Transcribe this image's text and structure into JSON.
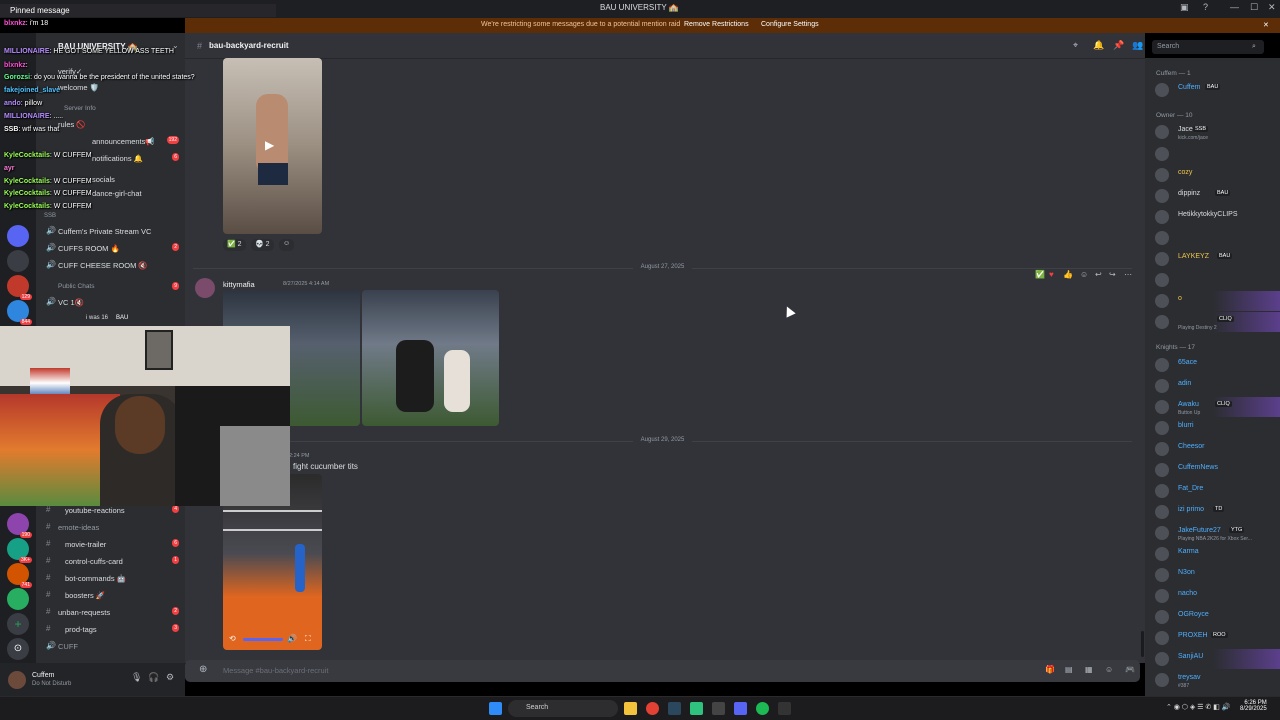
{
  "window": {
    "title": "BAU UNIVERSITY 🏫",
    "notice": "We're restricting some messages due to a potential mention raid",
    "notice_btn1": "Remove Restrictions",
    "notice_btn2": "Configure Settings"
  },
  "chat_overlay": {
    "pinned": "Pinned message",
    "lines": [
      {
        "nick": "blxnkz",
        "color": "#ff4fd8",
        "text": ": i'm 18"
      },
      {
        "nick": "MILLIONAIRE",
        "color": "#b58cff",
        "text": ": HE GOT SOME YELLOW ASS TEETH"
      },
      {
        "nick": "blxnkz",
        "color": "#ff4fd8",
        "text": ":"
      },
      {
        "nick": "Gorozsi",
        "color": "#63ff90",
        "text": ": do you wanna be the president of the united states?"
      },
      {
        "nick": "fakejoined_slave",
        "color": "#4fc3ff",
        "text": ""
      },
      {
        "nick": "ando",
        "color": "#b58cff",
        "text": ": pillow"
      },
      {
        "nick": "MILLIONAIRE",
        "color": "#b58cff",
        "text": ": ....."
      },
      {
        "nick": "SSB",
        "color": "#ffffff",
        "text": ": wtf was that"
      },
      {
        "nick": "KyleCocktails",
        "color": "#9cff57",
        "text": ": W CUFFEM"
      },
      {
        "nick": "ayr",
        "color": "#ff7ad9",
        "text": ""
      },
      {
        "nick": "KyleCocktails",
        "color": "#9cff57",
        "text": ": W CUFFEM"
      },
      {
        "nick": "KyleCocktails",
        "color": "#9cff57",
        "text": ": W CUFFEM"
      },
      {
        "nick": "KyleCocktails",
        "color": "#9cff57",
        "text": ": W CUFFEM"
      }
    ]
  },
  "sidebar": {
    "server_name": "BAU UNIVERSITY 🏫",
    "channels_top": [
      {
        "name": "verify✓",
        "count": ""
      },
      {
        "name": "welcome 🛡️",
        "count": ""
      },
      {
        "name": "Server Info",
        "count": ""
      },
      {
        "name": "rules 🚫",
        "count": ""
      },
      {
        "name": "announcements📢",
        "count": "192"
      },
      {
        "name": "notifications 🔔",
        "count": "6"
      },
      {
        "name": "socials",
        "count": ""
      },
      {
        "name": "dance-girl-chat",
        "count": ""
      },
      {
        "name": "SSB",
        "count": ""
      }
    ],
    "voice": [
      {
        "name": "Cuffem's Private Stream VC",
        "count": ""
      },
      {
        "name": "CUFFS ROOM 🔥",
        "count": "2"
      },
      {
        "name": "CUFF CHEESE ROOM 🔇",
        "count": ""
      },
      {
        "name": "Public Chats",
        "count": "9"
      },
      {
        "name": "VC 1🔇",
        "count": ""
      }
    ],
    "voice_user": "i was 16",
    "voice_user_tag": "BAU",
    "channels_bottom": [
      {
        "name": "youtube-reactions",
        "count": "4"
      },
      {
        "name": "emote-ideas",
        "count": ""
      },
      {
        "name": "movie-trailer",
        "count": "6"
      },
      {
        "name": "control-cuffs-card",
        "count": "1"
      },
      {
        "name": "bot-commands 🤖",
        "count": ""
      },
      {
        "name": "boosters 🚀",
        "count": ""
      },
      {
        "name": "unban-requests",
        "count": "2"
      },
      {
        "name": "prod-tags",
        "count": "3"
      },
      {
        "name": "CUFF",
        "count": ""
      }
    ],
    "user_name": "Cuffem",
    "user_status": "Do Not Disturb"
  },
  "main": {
    "channel": "bau-backyard-recruit",
    "search_placeholder": "Search",
    "reactions": [
      {
        "emoji": "✅",
        "count": "2"
      },
      {
        "emoji": "💀",
        "count": "2"
      }
    ],
    "date1": "August 27, 2025",
    "msg1_author": "kittymafia",
    "msg1_time": "8/27/2025 4:14 AM",
    "date2": "August 29, 2025",
    "msg2_time": "2:24 PM",
    "msg2_text": "fight cucumber tits",
    "compose_placeholder": "Message #bau-backyard-recruit"
  },
  "members": {
    "groups": [
      {
        "label": "Cuffem — 1"
      },
      {
        "label": "Owner — 10"
      },
      {
        "label": "Knights — 17"
      }
    ],
    "list": [
      {
        "name": "Cuffem",
        "color": "#4fb0ff",
        "tag": "BAU",
        "sub": ""
      },
      {
        "name": "Jace",
        "color": "#dbdee1",
        "tag": "SSB",
        "sub": "kick.com/jace"
      },
      {
        "name": "",
        "color": "#6d6f78",
        "tag": "",
        "sub": ""
      },
      {
        "name": "cozy",
        "color": "#f0c64a",
        "tag": "",
        "sub": ""
      },
      {
        "name": "dippinz",
        "color": "#dbdee1",
        "tag": "BAU",
        "sub": ""
      },
      {
        "name": "HetikkytokkyCLIPS",
        "color": "#dbdee1",
        "tag": "",
        "sub": ""
      },
      {
        "name": "",
        "color": "#6d6f78",
        "tag": "",
        "sub": ""
      },
      {
        "name": "LAYKEYZ",
        "color": "#f0c64a",
        "tag": "BAU",
        "sub": ""
      },
      {
        "name": "",
        "color": "#6d6f78",
        "tag": "",
        "sub": ""
      },
      {
        "name": "o",
        "color": "#f0c64a",
        "tag": "",
        "sub": ""
      },
      {
        "name": "",
        "color": "#b58cff",
        "tag": "CLIQ",
        "sub": "Playing Destiny 2"
      },
      {
        "name": "65ace",
        "color": "#4fb0ff",
        "tag": "",
        "sub": ""
      },
      {
        "name": "adin",
        "color": "#4fb0ff",
        "tag": "",
        "sub": ""
      },
      {
        "name": "Awaku",
        "color": "#4fb0ff",
        "tag": "CLIQ",
        "sub": "Button Up"
      },
      {
        "name": "blurri",
        "color": "#4fb0ff",
        "tag": "",
        "sub": ""
      },
      {
        "name": "Cheesor",
        "color": "#4fb0ff",
        "tag": "",
        "sub": ""
      },
      {
        "name": "CuffemNews",
        "color": "#4fb0ff",
        "tag": "",
        "sub": ""
      },
      {
        "name": "Fat_Dre",
        "color": "#4fb0ff",
        "tag": "",
        "sub": ""
      },
      {
        "name": "izi primo",
        "color": "#4fb0ff",
        "tag": "TD",
        "sub": ""
      },
      {
        "name": "JakeFuture27",
        "color": "#4fb0ff",
        "tag": "YTG",
        "sub": "Playing NBA 2K26 for Xbox Ser..."
      },
      {
        "name": "Karma",
        "color": "#4fb0ff",
        "tag": "",
        "sub": ""
      },
      {
        "name": "N3on",
        "color": "#4fb0ff",
        "tag": "",
        "sub": ""
      },
      {
        "name": "nacho",
        "color": "#4fb0ff",
        "tag": "",
        "sub": ""
      },
      {
        "name": "OGRoyce",
        "color": "#4fb0ff",
        "tag": "",
        "sub": ""
      },
      {
        "name": "PROXEH",
        "color": "#4fb0ff",
        "tag": "ROO",
        "sub": ""
      },
      {
        "name": "SanjiAU",
        "color": "#4fb0ff",
        "tag": "",
        "sub": ""
      },
      {
        "name": "treysav",
        "color": "#4fb0ff",
        "tag": "",
        "sub": "#387"
      }
    ]
  },
  "taskbar": {
    "search": "Search",
    "time": "6:26 PM",
    "date": "8/29/2025"
  }
}
